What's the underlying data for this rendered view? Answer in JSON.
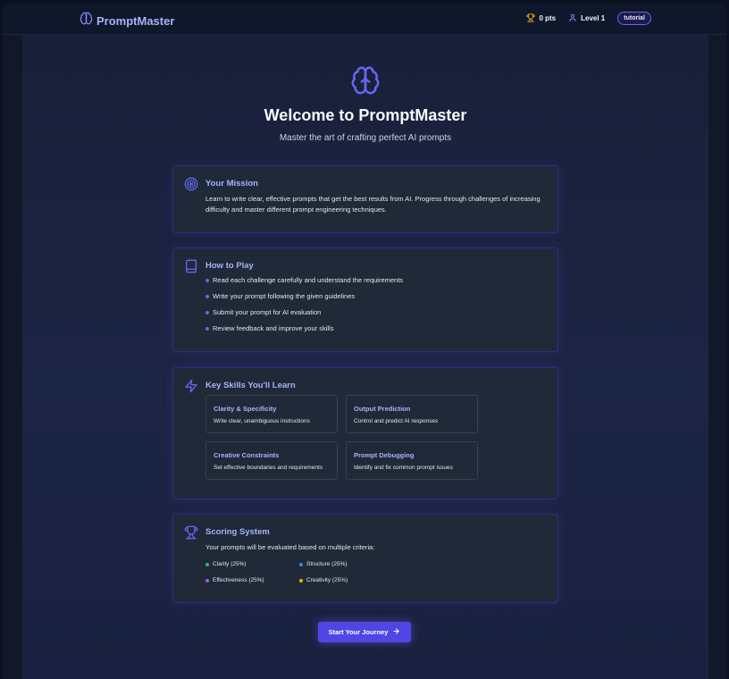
{
  "app": {
    "name": "PromptMaster"
  },
  "header": {
    "points": "0 pts",
    "level": "Level 1",
    "mode": "tutorial"
  },
  "hero": {
    "title": "Welcome to PromptMaster",
    "subtitle": "Master the art of crafting perfect AI prompts"
  },
  "mission": {
    "title": "Your Mission",
    "text": "Learn to write clear, effective prompts that get the best results from AI. Progress through challenges of increasing difficulty and master different prompt engineering techniques."
  },
  "how_to_play": {
    "title": "How to Play",
    "steps": [
      "Read each challenge carefully and understand the requirements",
      "Write your prompt following the given guidelines",
      "Submit your prompt for AI evaluation",
      "Review feedback and improve your skills"
    ]
  },
  "skills": {
    "title": "Key Skills You'll Learn",
    "items": [
      {
        "title": "Clarity & Specificity",
        "desc": "Write clear, unambiguous instructions"
      },
      {
        "title": "Output Prediction",
        "desc": "Control and predict AI responses"
      },
      {
        "title": "Creative Constraints",
        "desc": "Set effective boundaries and requirements"
      },
      {
        "title": "Prompt Debugging",
        "desc": "Identify and fix common prompt issues"
      }
    ]
  },
  "scoring": {
    "title": "Scoring System",
    "intro": "Your prompts will be evaluated based on multiple criteria:",
    "criteria": [
      {
        "label": "Clarity (25%)",
        "color": "#22c55e"
      },
      {
        "label": "Structure (25%)",
        "color": "#3b82f6"
      },
      {
        "label": "Effectiveness (25%)",
        "color": "#a855f7"
      },
      {
        "label": "Creativity (25%)",
        "color": "#eab308"
      }
    ]
  },
  "cta": {
    "label": "Start Your Journey"
  },
  "colors": {
    "accent": "#6366f1",
    "accent_light": "#a5b4fc",
    "background": "#1a2039"
  },
  "icons": [
    "brain-icon",
    "trophy-icon",
    "user-icon",
    "target-icon",
    "book-icon",
    "lightning-icon",
    "arrow-right-icon"
  ]
}
